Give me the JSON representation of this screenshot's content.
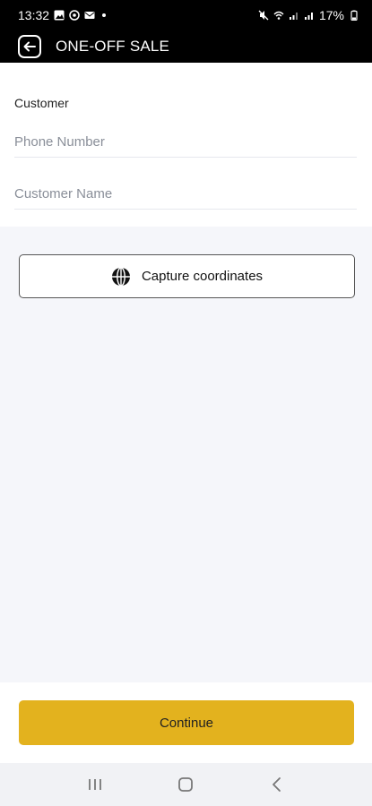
{
  "status_bar": {
    "time": "13:32",
    "battery": "17%",
    "icons": [
      "gallery-icon",
      "whatsapp-icon",
      "mail-icon",
      "mute-icon",
      "wifi-icon",
      "signal-icon",
      "battery-icon"
    ]
  },
  "app_bar": {
    "title": "ONE-OFF SALE",
    "back_icon": "back-arrow-icon"
  },
  "customer_section": {
    "label": "Customer",
    "phone_placeholder": "Phone Number",
    "phone_value": "",
    "name_placeholder": "Customer Name",
    "name_value": ""
  },
  "capture_button": {
    "label": "Capture coordinates",
    "icon": "globe-icon"
  },
  "continue_button": {
    "label": "Continue",
    "color": "#e3b21e"
  },
  "nav_bar": {
    "items": [
      "recent-apps-icon",
      "home-icon",
      "back-icon"
    ]
  },
  "colors": {
    "header_bg": "#000000",
    "accent": "#e3b21e",
    "page_bg": "#f5f6fa"
  }
}
